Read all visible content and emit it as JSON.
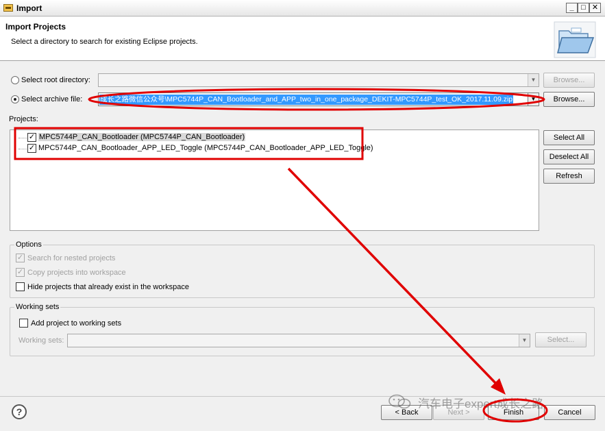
{
  "window": {
    "title": "Import"
  },
  "controls": {
    "minimize": "_",
    "maximize": "□",
    "close": "✕"
  },
  "header": {
    "title": "Import Projects",
    "subtitle": "Select a directory to search for existing Eclipse projects.",
    "icon": "folder-import-icon"
  },
  "source": {
    "root_label": "Select root directory:",
    "root_value": "",
    "root_browse": "Browse...",
    "archive_label": "Select archive file:",
    "archive_value": "成长之路微信公众号\\MPC5744P_CAN_Bootloader_and_APP_two_in_one_package_DEKIT-MPC5744P_test_OK_2017.11.09.zip",
    "archive_browse": "Browse...",
    "selected": "archive"
  },
  "projects": {
    "label": "Projects:",
    "items": [
      {
        "label": "MPC5744P_CAN_Bootloader (MPC5744P_CAN_Bootloader)",
        "checked": true
      },
      {
        "label": "MPC5744P_CAN_Bootloader_APP_LED_Toggle (MPC5744P_CAN_Bootloader_APP_LED_Toggle)",
        "checked": true
      }
    ],
    "select_all": "Select All",
    "deselect_all": "Deselect All",
    "refresh": "Refresh"
  },
  "options": {
    "title": "Options",
    "nested": "Search for nested projects",
    "copy": "Copy projects into workspace",
    "hide": "Hide projects that already exist in the workspace"
  },
  "working_sets": {
    "title": "Working sets",
    "add": "Add project to working sets",
    "label": "Working sets:",
    "value": "",
    "select": "Select..."
  },
  "footer": {
    "help": "?",
    "back": "< Back",
    "next": "Next >",
    "finish": "Finish",
    "cancel": "Cancel"
  },
  "watermark": {
    "text": "汽车电子expert成长之路"
  },
  "annotation_color": "#e00000"
}
